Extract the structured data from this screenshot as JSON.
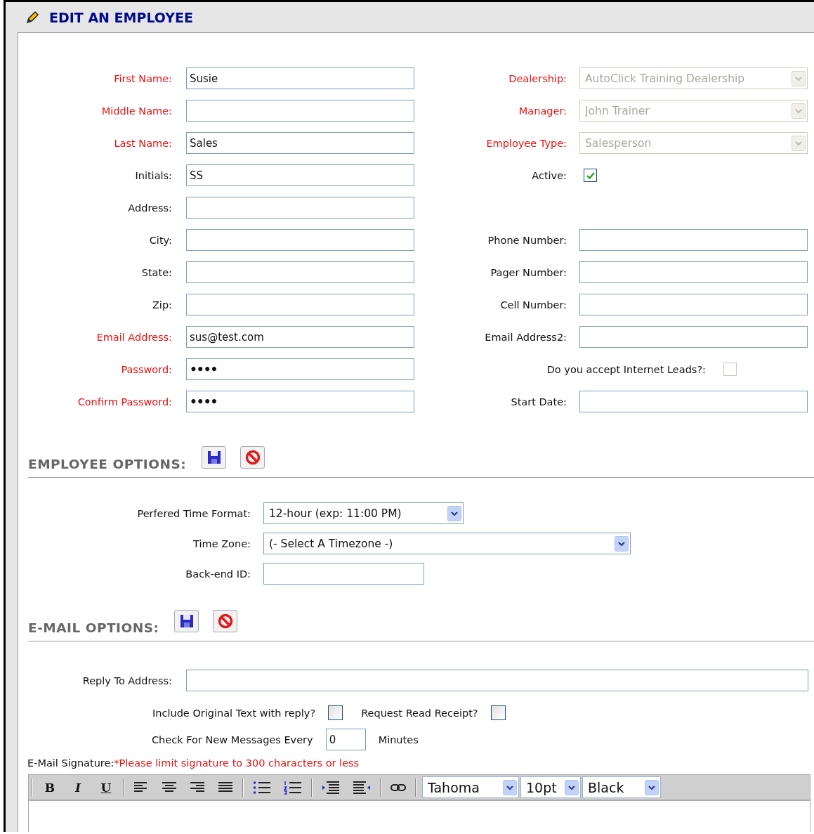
{
  "header": {
    "title": "EDIT AN EMPLOYEE"
  },
  "rows": [
    {
      "left": {
        "label": "First Name:",
        "required": true,
        "kind": "text",
        "value": "Susie"
      },
      "right": {
        "label": "Dealership:",
        "required": true,
        "kind": "select",
        "value": "AutoClick Training Dealership",
        "disabled": true
      }
    },
    {
      "left": {
        "label": "Middle Name:",
        "required": true,
        "kind": "text"
      },
      "right": {
        "label": "Manager:",
        "required": true,
        "kind": "select",
        "value": "John Trainer",
        "disabled": true
      }
    },
    {
      "left": {
        "label": "Last Name:",
        "required": true,
        "kind": "text",
        "value": "Sales"
      },
      "right": {
        "label": "Employee Type:",
        "required": true,
        "kind": "select",
        "value": "Salesperson",
        "disabled": true
      }
    },
    {
      "left": {
        "label": "Initials:",
        "required": false,
        "kind": "text",
        "value": "SS"
      },
      "right": {
        "label": "Active:",
        "required": false,
        "kind": "checkbox",
        "checked": true,
        "disabled": false
      }
    },
    {
      "left": {
        "label": "Address:",
        "required": false,
        "kind": "text"
      }
    },
    {
      "left": {
        "label": "City:",
        "required": false,
        "kind": "text"
      },
      "right": {
        "label": "Phone Number:",
        "required": false,
        "kind": "text"
      }
    },
    {
      "left": {
        "label": "State:",
        "required": false,
        "kind": "text"
      },
      "right": {
        "label": "Pager Number:",
        "required": false,
        "kind": "text"
      }
    },
    {
      "left": {
        "label": "Zip:",
        "required": false,
        "kind": "text"
      },
      "right": {
        "label": "Cell Number:",
        "required": false,
        "kind": "text"
      }
    },
    {
      "left": {
        "label": "Email Address:",
        "required": true,
        "kind": "text",
        "value": "sus@test.com"
      },
      "right": {
        "label": "Email Address2:",
        "required": false,
        "kind": "text"
      }
    },
    {
      "left": {
        "label": "Password:",
        "required": true,
        "kind": "password",
        "value": "••••"
      },
      "right": {
        "label": "Do you accept Internet Leads?:",
        "required": false,
        "kind": "question",
        "checked": false,
        "disabled": true
      }
    },
    {
      "left": {
        "label": "Confirm Password:",
        "required": true,
        "kind": "password",
        "value": "••••"
      },
      "right": {
        "label": "Start Date:",
        "required": false,
        "kind": "text"
      }
    }
  ],
  "employee_options": {
    "title": "EMPLOYEE OPTIONS:",
    "rows": [
      {
        "label": "Perfered Time Format:",
        "kind": "select",
        "value": "12-hour (exp: 11:00 PM)"
      },
      {
        "label": "Time Zone:",
        "kind": "select",
        "value": "(- Select A Timezone -)"
      },
      {
        "label": "Back-end ID:",
        "kind": "text"
      }
    ]
  },
  "email_options": {
    "title": "E-MAIL OPTIONS:",
    "reply_to": {
      "label": "Reply To Address:"
    },
    "checkboxes": [
      {
        "label": "Include Original Text with reply?",
        "checked": false
      },
      {
        "label": "Request Read Receipt?",
        "checked": false
      }
    ],
    "interval": {
      "label": "Check For New Messages Every",
      "value": "0",
      "unit": "Minutes"
    },
    "signature": {
      "label": "E-Mail Signature:",
      "note": "*Please limit signature to 300 characters or less"
    },
    "toolbar": {
      "format_buttons": [
        {
          "kind": "bold",
          "label": "B"
        },
        {
          "kind": "italic",
          "label": "I"
        },
        {
          "kind": "underline",
          "label": "U"
        }
      ],
      "font": "Tahoma",
      "size": "10pt",
      "font_color": "Black"
    }
  }
}
